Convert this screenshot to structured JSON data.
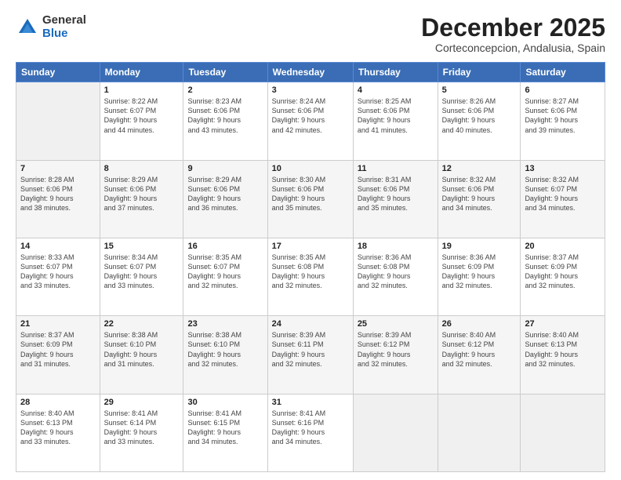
{
  "logo": {
    "general": "General",
    "blue": "Blue"
  },
  "title": "December 2025",
  "subtitle": "Corteconcepcion, Andalusia, Spain",
  "headers": [
    "Sunday",
    "Monday",
    "Tuesday",
    "Wednesday",
    "Thursday",
    "Friday",
    "Saturday"
  ],
  "weeks": [
    [
      {
        "day": "",
        "info": ""
      },
      {
        "day": "1",
        "info": "Sunrise: 8:22 AM\nSunset: 6:07 PM\nDaylight: 9 hours\nand 44 minutes."
      },
      {
        "day": "2",
        "info": "Sunrise: 8:23 AM\nSunset: 6:06 PM\nDaylight: 9 hours\nand 43 minutes."
      },
      {
        "day": "3",
        "info": "Sunrise: 8:24 AM\nSunset: 6:06 PM\nDaylight: 9 hours\nand 42 minutes."
      },
      {
        "day": "4",
        "info": "Sunrise: 8:25 AM\nSunset: 6:06 PM\nDaylight: 9 hours\nand 41 minutes."
      },
      {
        "day": "5",
        "info": "Sunrise: 8:26 AM\nSunset: 6:06 PM\nDaylight: 9 hours\nand 40 minutes."
      },
      {
        "day": "6",
        "info": "Sunrise: 8:27 AM\nSunset: 6:06 PM\nDaylight: 9 hours\nand 39 minutes."
      }
    ],
    [
      {
        "day": "7",
        "info": "Sunrise: 8:28 AM\nSunset: 6:06 PM\nDaylight: 9 hours\nand 38 minutes."
      },
      {
        "day": "8",
        "info": "Sunrise: 8:29 AM\nSunset: 6:06 PM\nDaylight: 9 hours\nand 37 minutes."
      },
      {
        "day": "9",
        "info": "Sunrise: 8:29 AM\nSunset: 6:06 PM\nDaylight: 9 hours\nand 36 minutes."
      },
      {
        "day": "10",
        "info": "Sunrise: 8:30 AM\nSunset: 6:06 PM\nDaylight: 9 hours\nand 35 minutes."
      },
      {
        "day": "11",
        "info": "Sunrise: 8:31 AM\nSunset: 6:06 PM\nDaylight: 9 hours\nand 35 minutes."
      },
      {
        "day": "12",
        "info": "Sunrise: 8:32 AM\nSunset: 6:06 PM\nDaylight: 9 hours\nand 34 minutes."
      },
      {
        "day": "13",
        "info": "Sunrise: 8:32 AM\nSunset: 6:07 PM\nDaylight: 9 hours\nand 34 minutes."
      }
    ],
    [
      {
        "day": "14",
        "info": "Sunrise: 8:33 AM\nSunset: 6:07 PM\nDaylight: 9 hours\nand 33 minutes."
      },
      {
        "day": "15",
        "info": "Sunrise: 8:34 AM\nSunset: 6:07 PM\nDaylight: 9 hours\nand 33 minutes."
      },
      {
        "day": "16",
        "info": "Sunrise: 8:35 AM\nSunset: 6:07 PM\nDaylight: 9 hours\nand 32 minutes."
      },
      {
        "day": "17",
        "info": "Sunrise: 8:35 AM\nSunset: 6:08 PM\nDaylight: 9 hours\nand 32 minutes."
      },
      {
        "day": "18",
        "info": "Sunrise: 8:36 AM\nSunset: 6:08 PM\nDaylight: 9 hours\nand 32 minutes."
      },
      {
        "day": "19",
        "info": "Sunrise: 8:36 AM\nSunset: 6:09 PM\nDaylight: 9 hours\nand 32 minutes."
      },
      {
        "day": "20",
        "info": "Sunrise: 8:37 AM\nSunset: 6:09 PM\nDaylight: 9 hours\nand 32 minutes."
      }
    ],
    [
      {
        "day": "21",
        "info": "Sunrise: 8:37 AM\nSunset: 6:09 PM\nDaylight: 9 hours\nand 31 minutes."
      },
      {
        "day": "22",
        "info": "Sunrise: 8:38 AM\nSunset: 6:10 PM\nDaylight: 9 hours\nand 31 minutes."
      },
      {
        "day": "23",
        "info": "Sunrise: 8:38 AM\nSunset: 6:10 PM\nDaylight: 9 hours\nand 32 minutes."
      },
      {
        "day": "24",
        "info": "Sunrise: 8:39 AM\nSunset: 6:11 PM\nDaylight: 9 hours\nand 32 minutes."
      },
      {
        "day": "25",
        "info": "Sunrise: 8:39 AM\nSunset: 6:12 PM\nDaylight: 9 hours\nand 32 minutes."
      },
      {
        "day": "26",
        "info": "Sunrise: 8:40 AM\nSunset: 6:12 PM\nDaylight: 9 hours\nand 32 minutes."
      },
      {
        "day": "27",
        "info": "Sunrise: 8:40 AM\nSunset: 6:13 PM\nDaylight: 9 hours\nand 32 minutes."
      }
    ],
    [
      {
        "day": "28",
        "info": "Sunrise: 8:40 AM\nSunset: 6:13 PM\nDaylight: 9 hours\nand 33 minutes."
      },
      {
        "day": "29",
        "info": "Sunrise: 8:41 AM\nSunset: 6:14 PM\nDaylight: 9 hours\nand 33 minutes."
      },
      {
        "day": "30",
        "info": "Sunrise: 8:41 AM\nSunset: 6:15 PM\nDaylight: 9 hours\nand 34 minutes."
      },
      {
        "day": "31",
        "info": "Sunrise: 8:41 AM\nSunset: 6:16 PM\nDaylight: 9 hours\nand 34 minutes."
      },
      {
        "day": "",
        "info": ""
      },
      {
        "day": "",
        "info": ""
      },
      {
        "day": "",
        "info": ""
      }
    ]
  ]
}
